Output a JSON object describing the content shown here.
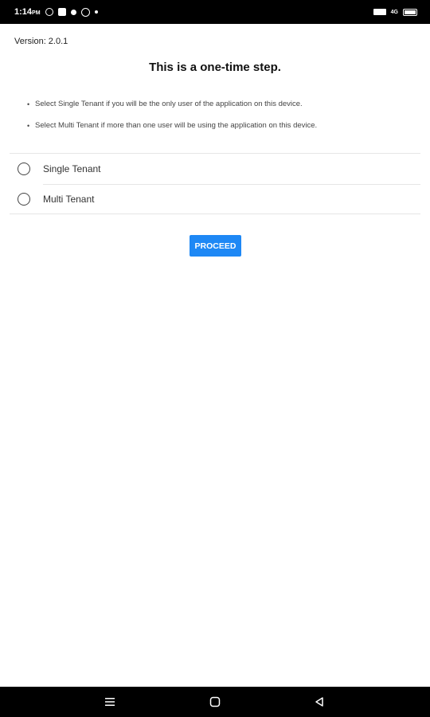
{
  "status_bar": {
    "time": "1:14",
    "time_suffix": "PM",
    "network": "4G",
    "icons": [
      "whatsapp-icon",
      "app-icon",
      "dot-icon",
      "globe-icon",
      "notification-dot-icon",
      "signal-icon",
      "battery-icon"
    ]
  },
  "version_text": "Version: 2.0.1",
  "title": "This is a one-time step.",
  "instructions": [
    "Select Single Tenant if you will be the only user of the application on this device.",
    "Select Multi Tenant if more than one user will be using the application on this device."
  ],
  "options": [
    {
      "label": "Single Tenant",
      "selected": false
    },
    {
      "label": "Multi Tenant",
      "selected": false
    }
  ],
  "proceed_label": "PROCEED",
  "colors": {
    "accent": "#1e88f5",
    "status_bar": "#000000",
    "nav_bar": "#000000",
    "background": "#ffffff"
  },
  "nav_bar": {
    "icons": [
      "menu-icon",
      "home-icon",
      "back-icon"
    ]
  }
}
